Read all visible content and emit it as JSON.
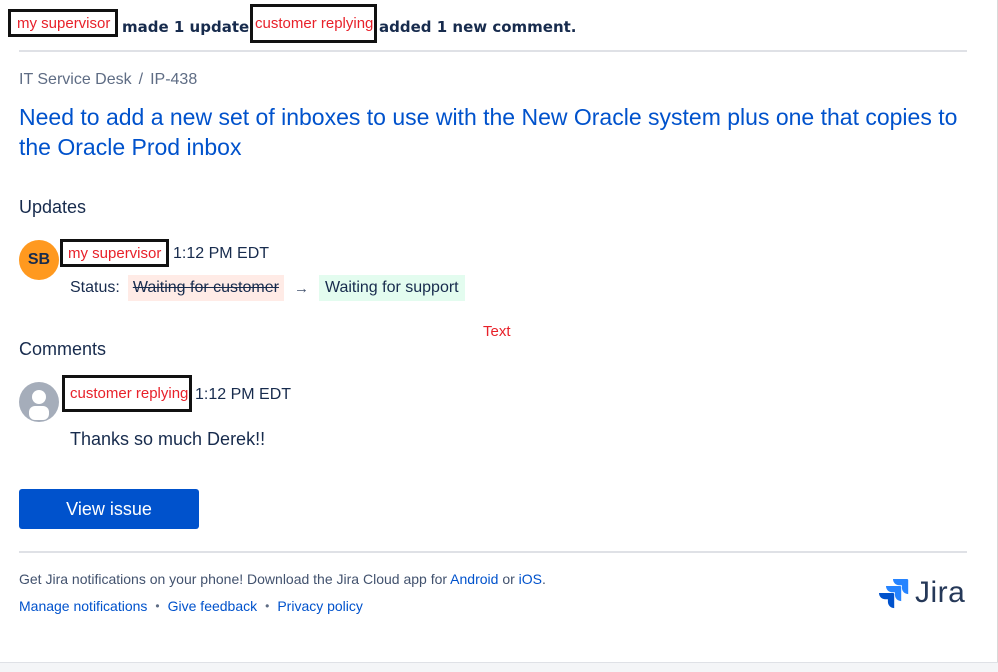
{
  "summary": {
    "actor1": "my supervisor",
    "text1": "made 1 update.",
    "actor2": "customer replying",
    "text2": "added 1 new comment."
  },
  "issue": {
    "breadcrumb_project": "IT Service Desk",
    "breadcrumb_sep": "/",
    "breadcrumb_key": "IP-438",
    "title": "Need to add a new set of inboxes to use with the New Oracle system plus one that copies to the Oracle Prod inbox"
  },
  "updates": {
    "heading": "Updates",
    "avatar_initials": "SB",
    "author": "my supervisor",
    "time": "1:12 PM EDT",
    "status_label": "Status:",
    "old_status": "Waiting for customer",
    "arrow": "→",
    "new_status": "Waiting for support"
  },
  "annotation": {
    "text": "Text"
  },
  "comments": {
    "heading": "Comments",
    "author": "customer replying",
    "time": "1:12 PM EDT",
    "body": "Thanks so much Derek!!"
  },
  "actions": {
    "view_issue": "View issue"
  },
  "footer": {
    "app_text_prefix": "Get Jira notifications on your phone! Download the Jira Cloud app for",
    "android": "Android",
    "or": "or",
    "ios": "iOS",
    "period": ".",
    "manage": "Manage notifications",
    "feedback": "Give feedback",
    "privacy": "Privacy policy",
    "bullet": "•"
  },
  "brand": {
    "name": "Jira",
    "color": "#2684ff"
  },
  "colors": {
    "link": "#0052cc",
    "annotation_red": "#e8212a",
    "avatar_orange": "#ff991f"
  }
}
